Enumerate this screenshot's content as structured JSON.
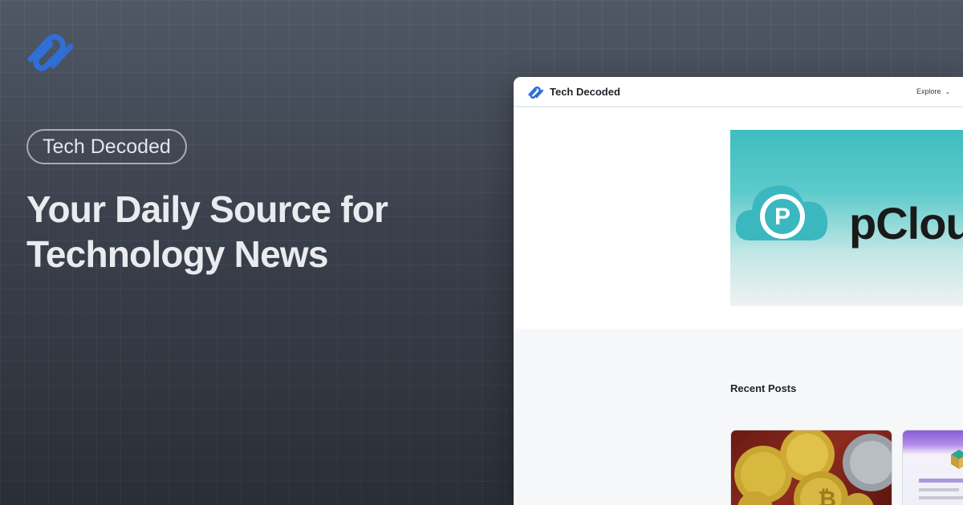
{
  "banner": {
    "pill_label": "Tech Decoded",
    "headline_line1": "Your Daily Source for",
    "headline_line2": "Technology News",
    "logo_icon": "paperclip-link-logo-icon",
    "accent": "#2f6fd6"
  },
  "preview": {
    "site_name": "Tech Decoded",
    "nav_explore": "Explore",
    "hero": {
      "brand_text": "pCloud",
      "brand_visible_text": "pClou",
      "icon": "p-cloud-icon"
    },
    "recent_posts_title": "Recent Posts",
    "posts": [
      {
        "image": "crypto-coins-thumbnail"
      },
      {
        "image": "app-screenshot-thumbnail"
      }
    ]
  }
}
